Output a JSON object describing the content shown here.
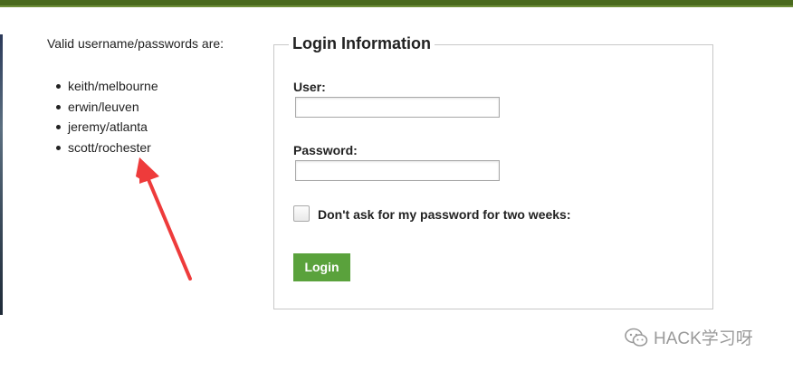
{
  "credentials": {
    "intro": "Valid username/passwords are:",
    "items": [
      "keith/melbourne",
      "erwin/leuven",
      "jeremy/atlanta",
      "scott/rochester"
    ]
  },
  "login": {
    "legend": "Login Information",
    "user_label": "User:",
    "user_value": "",
    "password_label": "Password:",
    "password_value": "",
    "remember_label": "Don't ask for my password for two weeks:",
    "remember_checked": false,
    "submit_label": "Login"
  },
  "annotation": {
    "arrow_color": "#ee3b3b",
    "icon": "arrow-up-icon"
  },
  "watermark": {
    "text": "HACK学习呀",
    "icon": "wechat-icon"
  },
  "colors": {
    "top_bar": "#4a6a1e",
    "button_bg": "#5aa23c",
    "button_text": "#ffffff",
    "border": "#c8c8c8"
  }
}
